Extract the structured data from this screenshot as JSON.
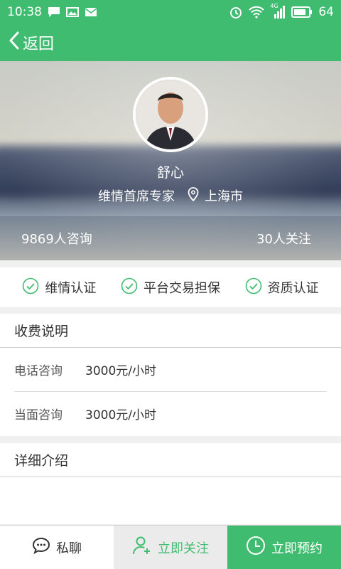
{
  "status_bar": {
    "time": "10:38",
    "network": "4G",
    "battery": "64"
  },
  "header": {
    "back_label": "返回"
  },
  "profile": {
    "name": "舒心",
    "title": "维情首席专家",
    "location": "上海市",
    "consult_count": "9869人咨询",
    "follow_count": "30人关注"
  },
  "certifications": [
    {
      "label": "维情认证"
    },
    {
      "label": "平台交易担保"
    },
    {
      "label": "资质认证"
    }
  ],
  "fees": {
    "title": "收费说明",
    "items": [
      {
        "label": "电话咨询",
        "value": "3000元/小时"
      },
      {
        "label": "当面咨询",
        "value": "3000元/小时"
      }
    ]
  },
  "detail": {
    "title": "详细介绍"
  },
  "bottom_bar": {
    "chat_label": "私聊",
    "follow_label": "立即关注",
    "book_label": "立即预约"
  },
  "colors": {
    "accent": "#3fbc6f"
  }
}
